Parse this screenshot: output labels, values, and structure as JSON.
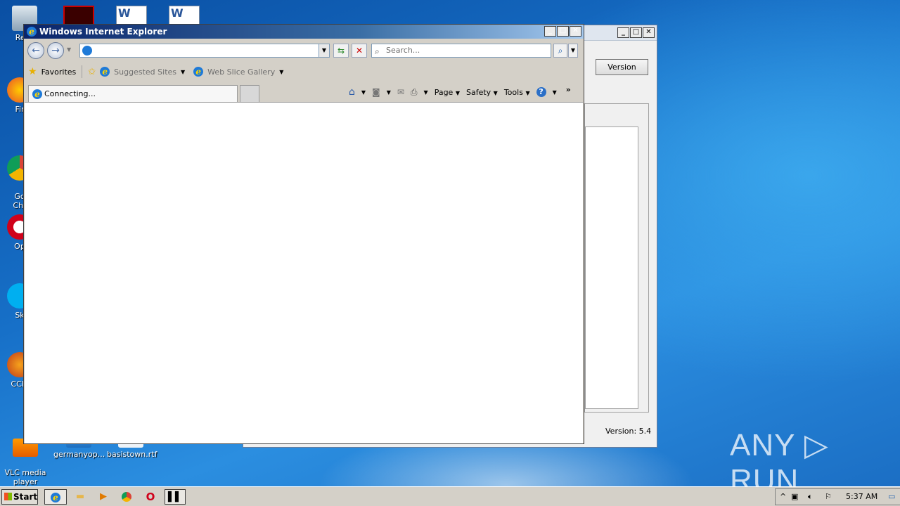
{
  "desktop": {
    "icons": [
      {
        "label": "Recy"
      },
      {
        "label": "Fir"
      },
      {
        "label": "Go\nChr"
      },
      {
        "label": "Op"
      },
      {
        "label": "Sk"
      },
      {
        "label": "CCle"
      },
      {
        "label": "VLC media\nplayer"
      },
      {
        "label": "germanyop..."
      },
      {
        "label": "basistown.rtf"
      }
    ]
  },
  "bg_dialog": {
    "version_button": "Version",
    "version_text": "Version: 5.4"
  },
  "ie": {
    "title": "Windows Internet Explorer",
    "address_value": "",
    "search_placeholder": "Search...",
    "favorites_label": "Favorites",
    "suggested_sites": "Suggested Sites",
    "web_slice_gallery": "Web Slice Gallery",
    "tab_label": "Connecting...",
    "commands": {
      "page": "Page",
      "safety": "Safety",
      "tools": "Tools"
    },
    "chevron": "»"
  },
  "taskbar": {
    "start_label": "Start",
    "clock": "5:37 AM"
  },
  "watermark": "ANY ▷ RUN"
}
